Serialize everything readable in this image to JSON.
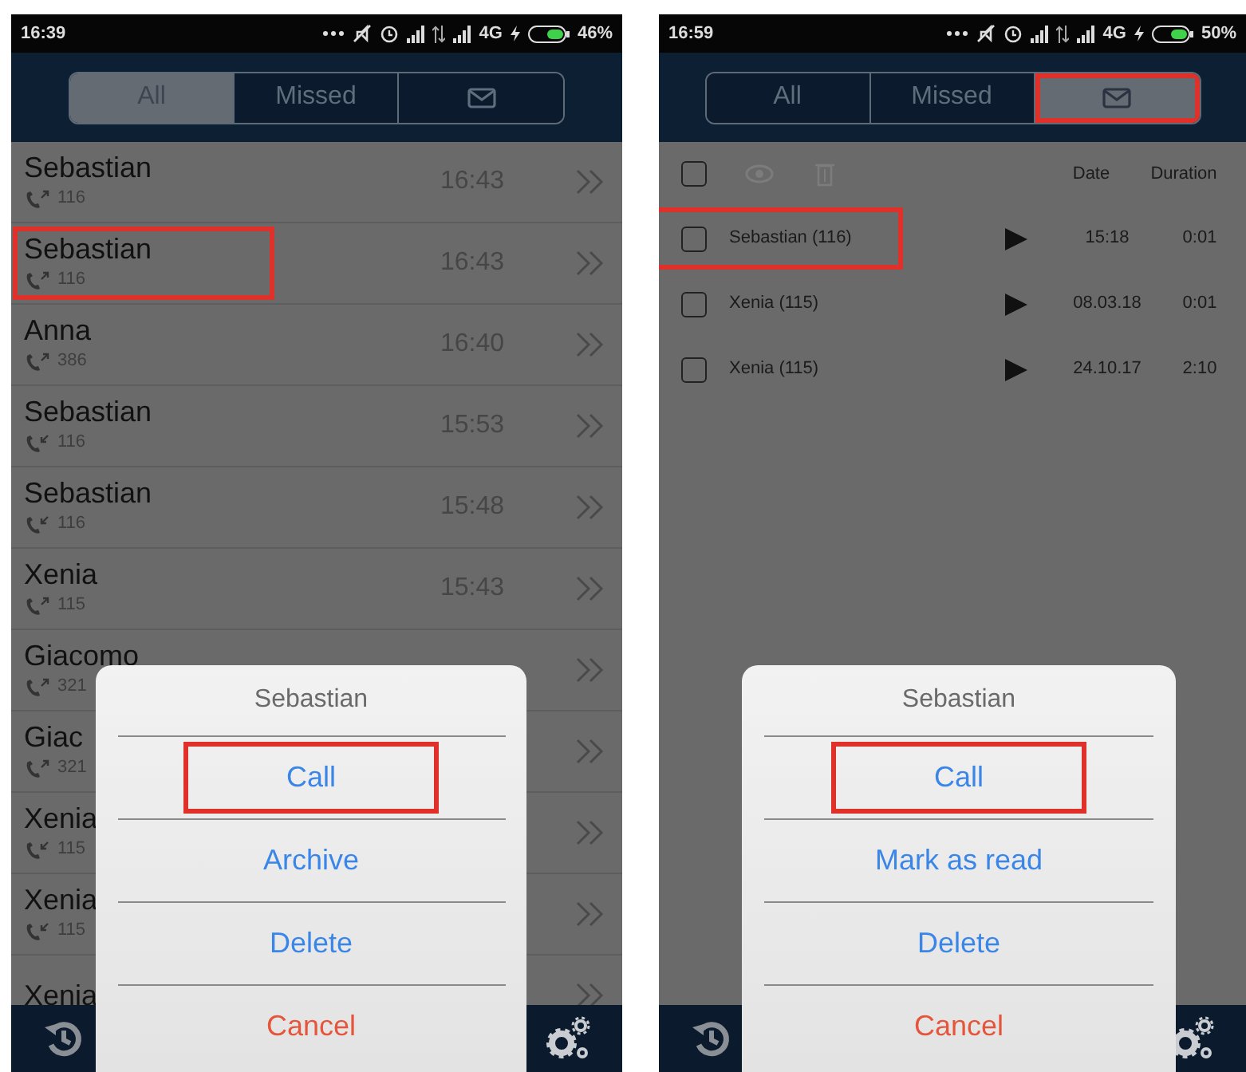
{
  "screens": [
    {
      "kind": "call_log",
      "status_bar": {
        "time": "16:39",
        "network": "4G",
        "battery": "46%"
      },
      "tabs": [
        {
          "kind": "text",
          "label": "All",
          "selected": true,
          "highlighted": false
        },
        {
          "kind": "text",
          "label": "Missed",
          "selected": false,
          "highlighted": false
        },
        {
          "kind": "mail",
          "selected": false,
          "highlighted": false
        }
      ],
      "calls": [
        {
          "name": "Sebastian",
          "number": "116",
          "outgoing": true,
          "time": "16:43",
          "highlighted": false
        },
        {
          "name": "Sebastian",
          "number": "116",
          "outgoing": true,
          "time": "16:43",
          "highlighted": true
        },
        {
          "name": "Anna",
          "number": "386",
          "outgoing": true,
          "time": "16:40",
          "highlighted": false
        },
        {
          "name": "Sebastian",
          "number": "116",
          "outgoing": false,
          "time": "15:53",
          "highlighted": false
        },
        {
          "name": "Sebastian",
          "number": "116",
          "outgoing": false,
          "time": "15:48",
          "highlighted": false
        },
        {
          "name": "Xenia",
          "number": "115",
          "outgoing": true,
          "time": "15:43",
          "highlighted": false
        },
        {
          "name": "Giacomo",
          "number": "321",
          "outgoing": true,
          "highlighted": false
        },
        {
          "name": "Giac",
          "number": "321",
          "outgoing": true,
          "highlighted": false
        },
        {
          "name": "Xenia",
          "number": "115",
          "outgoing": false,
          "highlighted": false
        },
        {
          "name": "Xenia",
          "number": "115",
          "outgoing": false,
          "highlighted": false
        },
        {
          "name": "Xenia",
          "highlighted": false
        }
      ],
      "dialog": {
        "title": "Sebastian",
        "actions": [
          {
            "kind": "action",
            "label": "Call",
            "highlighted": true
          },
          {
            "kind": "action",
            "label": "Archive",
            "highlighted": false
          },
          {
            "kind": "action",
            "label": "Delete",
            "highlighted": false
          },
          {
            "kind": "cancel",
            "label": "Cancel",
            "highlighted": false
          }
        ]
      }
    },
    {
      "kind": "voicemail",
      "status_bar": {
        "time": "16:59",
        "network": "4G",
        "battery": "50%"
      },
      "tabs": [
        {
          "kind": "text",
          "label": "All",
          "selected": false,
          "highlighted": false
        },
        {
          "kind": "text",
          "label": "Missed",
          "selected": false,
          "highlighted": false
        },
        {
          "kind": "mail",
          "selected": true,
          "highlighted": true
        }
      ],
      "select_all_checked": false,
      "columns": [
        "Date",
        "Duration"
      ],
      "messages": [
        {
          "name": "Sebastian (116)",
          "date": "15:18",
          "duration": "0:01",
          "checked": false,
          "highlighted": true
        },
        {
          "name": "Xenia (115)",
          "date": "08.03.18",
          "duration": "0:01",
          "checked": false,
          "highlighted": false
        },
        {
          "name": "Xenia (115)",
          "date": "24.10.17",
          "duration": "2:10",
          "checked": false,
          "highlighted": false
        }
      ],
      "dialog": {
        "title": "Sebastian",
        "actions": [
          {
            "kind": "action",
            "label": "Call",
            "highlighted": true
          },
          {
            "kind": "action",
            "label": "Mark as read",
            "highlighted": false
          },
          {
            "kind": "action",
            "label": "Delete",
            "highlighted": false
          },
          {
            "kind": "cancel",
            "label": "Cancel",
            "highlighted": false
          }
        ]
      }
    }
  ]
}
